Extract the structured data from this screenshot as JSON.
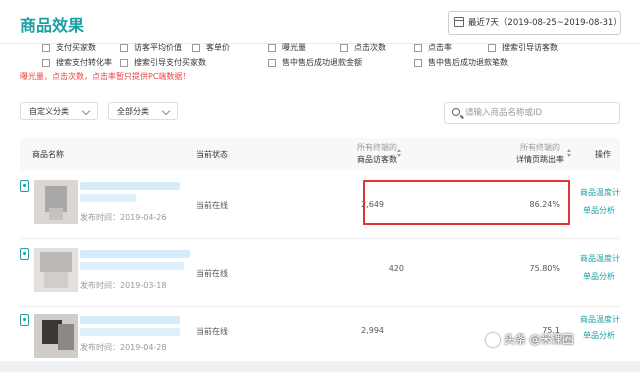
{
  "page": {
    "title": "商品效果"
  },
  "date_range": {
    "label": "最近7天（2019-08-25~2019-08-31）"
  },
  "options": [
    {
      "label": "支付买家数"
    },
    {
      "label": "访客平均价值"
    },
    {
      "label": "客单价"
    },
    {
      "label": "曝光量"
    },
    {
      "label": "点击次数"
    },
    {
      "label": "点击率"
    },
    {
      "label": "搜索引导访客数"
    },
    {
      "label": "搜索支付转化率"
    },
    {
      "label": "搜索引导支付买家数"
    },
    {
      "label": "售中售后成功退款金额"
    },
    {
      "label": "售中售后成功退款笔数"
    }
  ],
  "warning": "曝光量，点击次数，点击率暂只提供PC端数据！",
  "filters": {
    "category": "自定义分类",
    "all_category": "全部分类"
  },
  "search": {
    "placeholder": "请输入商品名称或ID"
  },
  "table": {
    "headers": {
      "name": "商品名称",
      "status": "当前状态",
      "visitors_sub": "所有终端的",
      "visitors": "商品访客数",
      "bounce_sub": "所有终端的",
      "bounce": "详情页跳出率",
      "actions": "操作"
    },
    "rows": [
      {
        "published": "发布时间：2019-04-26",
        "status": "当前在线",
        "visitors": "2,649",
        "bounce": "86.24%",
        "action1": "商品温度计",
        "action2": "单品分析"
      },
      {
        "published": "发布时间：2019-03-18",
        "status": "当前在线",
        "visitors": "420",
        "bounce": "75.80%",
        "action1": "商品温度计",
        "action2": "单品分析"
      },
      {
        "published": "发布时间：2019-04-28",
        "status": "当前在线",
        "visitors": "2,994",
        "bounce": "75.1",
        "action1": "商品温度计",
        "action2": "单品分析"
      }
    ]
  },
  "watermark": "头条 @米课圈"
}
